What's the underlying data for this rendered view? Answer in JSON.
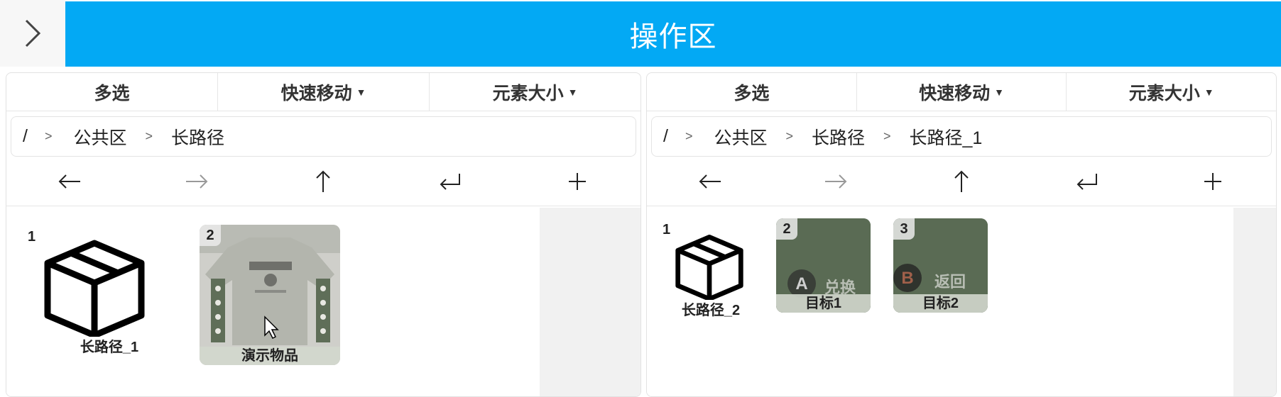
{
  "header": {
    "title": "操作区",
    "toggle_icon": "chevron-right-icon"
  },
  "colors": {
    "header_bg": "#03a9f4",
    "gray_area": "#f1f1f1",
    "thumb_green": "#5a6b54"
  },
  "panels": [
    {
      "toolbar": {
        "multi_select": "多选",
        "quick_move": "快速移动",
        "element_size": "元素大小"
      },
      "breadcrumb": [
        "/",
        "公共区",
        "长路径"
      ],
      "nav": [
        "back-arrow-icon",
        "forward-arrow-icon",
        "up-arrow-icon",
        "enter-icon",
        "add-icon"
      ],
      "items": [
        {
          "num": "1",
          "label": "长路径_1",
          "type": "folder"
        },
        {
          "num": "2",
          "label": "演示物品",
          "type": "image-shirt"
        }
      ]
    },
    {
      "toolbar": {
        "multi_select": "多选",
        "quick_move": "快速移动",
        "element_size": "元素大小"
      },
      "breadcrumb": [
        "/",
        "公共区",
        "长路径",
        "长路径_1"
      ],
      "nav": [
        "back-arrow-icon",
        "forward-arrow-icon",
        "up-arrow-icon",
        "enter-icon",
        "add-icon"
      ],
      "items": [
        {
          "num": "1",
          "label": "长路径_2",
          "type": "folder"
        },
        {
          "num": "2",
          "label": "目标1",
          "type": "image-button",
          "button_letter": "A",
          "button_text": "兑换"
        },
        {
          "num": "3",
          "label": "目标2",
          "type": "image-button",
          "button_letter": "B",
          "button_text": "返回"
        }
      ]
    }
  ]
}
